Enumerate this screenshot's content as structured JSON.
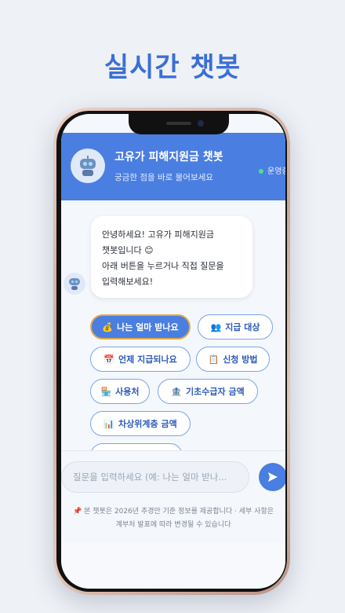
{
  "headline": "실시간 챗봇",
  "header": {
    "title": "고유가 피해지원금 챗봇",
    "subtitle": "궁금한 점을 바로 물어보세요",
    "status": "운영중",
    "avatar_icon": "robot-icon"
  },
  "message": {
    "line1": "안녕하세요! 고유가 피해지원금",
    "line2": "챗봇입니다 😊",
    "line3": "아래 버튼을 누르거나 직접 질문을",
    "line4": "입력해보세요!"
  },
  "chips": [
    {
      "icon": "💰",
      "label": "나는 얼마 받나요"
    },
    {
      "icon": "👥",
      "label": "지급 대상"
    },
    {
      "icon": "📅",
      "label": "언제 지급되나요"
    },
    {
      "icon": "📋",
      "label": "신청 방법"
    },
    {
      "icon": "🏪",
      "label": "사용처"
    },
    {
      "icon": "🏦",
      "label": "기초수급자 금액"
    },
    {
      "icon": "📊",
      "label": "차상위계층 금액"
    }
  ],
  "input": {
    "placeholder": "질문을 입력하세요 (예: 나는 얼마 받나..."
  },
  "send_icon": "send-icon",
  "disclaimer": {
    "line1": "📌 본 챗봇은 2026년 추경안 기준 정보를 제공합니다 · 세부 사항은",
    "line2": "계부처 발표에 따라 변경될 수 있습니다"
  },
  "colors": {
    "accent": "#4a7ee0",
    "headline": "#3b6fd6",
    "status_dot": "#4ee08a"
  }
}
